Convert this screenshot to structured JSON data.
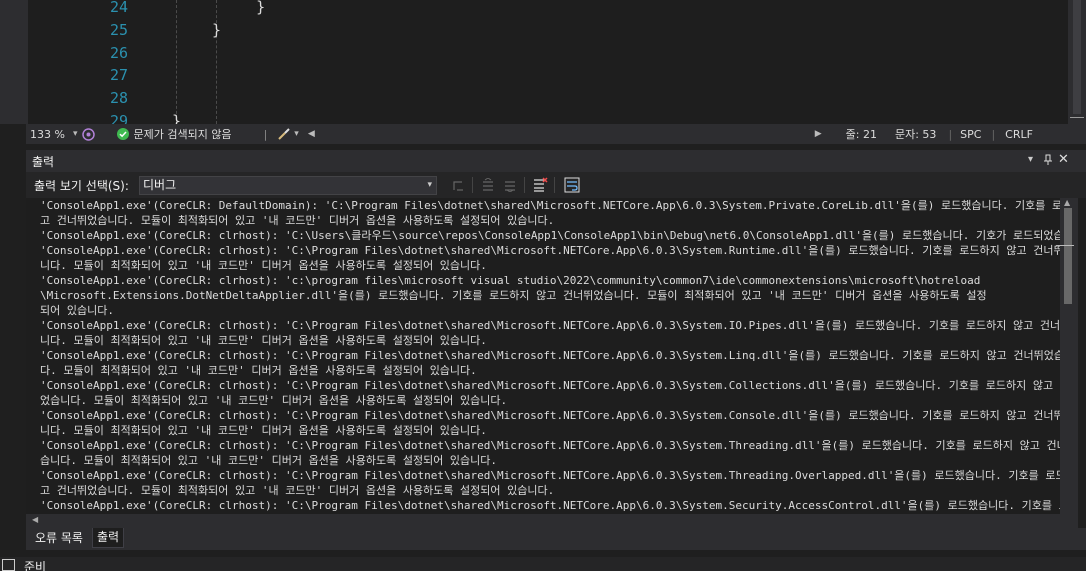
{
  "editor": {
    "lines": [
      {
        "num": "24",
        "code": "    }"
      },
      {
        "num": "25",
        "code": "}"
      },
      {
        "num": "26",
        "code": ""
      },
      {
        "num": "27",
        "code": ""
      },
      {
        "num": "28",
        "code": ""
      },
      {
        "num": "29",
        "code": "}"
      }
    ]
  },
  "editor_status": {
    "zoom": "133 %",
    "issues": "문제가 검색되지 않음",
    "line": "줄: 21",
    "char": "문자: 53",
    "whitespace": "SPC",
    "line_ending": "CRLF"
  },
  "output": {
    "title": "출력",
    "source_label": "출력 보기 선택(S):",
    "source_value": "디버그",
    "log": [
      "'ConsoleApp1.exe'(CoreCLR: DefaultDomain): 'C:\\Program Files\\dotnet\\shared\\Microsoft.NETCore.App\\6.0.3\\System.Private.CoreLib.dll'을(를) 로드했습니다. 기호를 로드하지 않",
      "   고 건너뛰었습니다. 모듈이 최적화되어 있고 '내 코드만' 디버거 옵션을 사용하도록 설정되어 있습니다.",
      "'ConsoleApp1.exe'(CoreCLR: clrhost): 'C:\\Users\\클라우드\\source\\repos\\ConsoleApp1\\ConsoleApp1\\bin\\Debug\\net6.0\\ConsoleApp1.dll'을(를) 로드했습니다. 기호가 로드되었습니다.",
      "'ConsoleApp1.exe'(CoreCLR: clrhost): 'C:\\Program Files\\dotnet\\shared\\Microsoft.NETCore.App\\6.0.3\\System.Runtime.dll'을(를) 로드했습니다. 기호를 로드하지 않고 건너뛰었습",
      "   니다. 모듈이 최적화되어 있고 '내 코드만' 디버거 옵션을 사용하도록 설정되어 있습니다.",
      "'ConsoleApp1.exe'(CoreCLR: clrhost): 'c:\\program files\\microsoft visual studio\\2022\\community\\common7\\ide\\commonextensions\\microsoft\\hotreload",
      "   \\Microsoft.Extensions.DotNetDeltaApplier.dll'을(를) 로드했습니다. 기호를 로드하지 않고 건너뛰었습니다. 모듈이 최적화되어 있고 '내 코드만' 디버거 옵션을 사용하도록 설정",
      "   되어 있습니다.",
      "'ConsoleApp1.exe'(CoreCLR: clrhost): 'C:\\Program Files\\dotnet\\shared\\Microsoft.NETCore.App\\6.0.3\\System.IO.Pipes.dll'을(를) 로드했습니다. 기호를 로드하지 않고 건너뛰었습",
      "   니다. 모듈이 최적화되어 있고 '내 코드만' 디버거 옵션을 사용하도록 설정되어 있습니다.",
      "'ConsoleApp1.exe'(CoreCLR: clrhost): 'C:\\Program Files\\dotnet\\shared\\Microsoft.NETCore.App\\6.0.3\\System.Linq.dll'을(를) 로드했습니다. 기호를 로드하지 않고 건너뛰었습니",
      "   다. 모듈이 최적화되어 있고 '내 코드만' 디버거 옵션을 사용하도록 설정되어 있습니다.",
      "'ConsoleApp1.exe'(CoreCLR: clrhost): 'C:\\Program Files\\dotnet\\shared\\Microsoft.NETCore.App\\6.0.3\\System.Collections.dll'을(를) 로드했습니다. 기호를 로드하지 않고 건너뛰",
      "   었습니다. 모듈이 최적화되어 있고 '내 코드만' 디버거 옵션을 사용하도록 설정되어 있습니다.",
      "'ConsoleApp1.exe'(CoreCLR: clrhost): 'C:\\Program Files\\dotnet\\shared\\Microsoft.NETCore.App\\6.0.3\\System.Console.dll'을(를) 로드했습니다. 기호를 로드하지 않고 건너뛰었습",
      "   니다. 모듈이 최적화되어 있고 '내 코드만' 디버거 옵션을 사용하도록 설정되어 있습니다.",
      "'ConsoleApp1.exe'(CoreCLR: clrhost): 'C:\\Program Files\\dotnet\\shared\\Microsoft.NETCore.App\\6.0.3\\System.Threading.dll'을(를) 로드했습니다. 기호를 로드하지 않고 건너뛰었",
      "   습니다. 모듈이 최적화되어 있고 '내 코드만' 디버거 옵션을 사용하도록 설정되어 있습니다.",
      "'ConsoleApp1.exe'(CoreCLR: clrhost): 'C:\\Program Files\\dotnet\\shared\\Microsoft.NETCore.App\\6.0.3\\System.Threading.Overlapped.dll'을(를) 로드했습니다. 기호를 로드하지 않",
      "   고 건너뛰었습니다. 모듈이 최적화되어 있고 '내 코드만' 디버거 옵션을 사용하도록 설정되어 있습니다.",
      "'ConsoleApp1.exe'(CoreCLR: clrhost): 'C:\\Program Files\\dotnet\\shared\\Microsoft.NETCore.App\\6.0.3\\System.Security.AccessControl.dll'을(를) 로드했습니다. 기호를 로드하지"
    ]
  },
  "tabs": [
    {
      "label": "오류 목록"
    },
    {
      "label": "출력"
    }
  ],
  "app_status": {
    "text": "준비"
  },
  "colors": {
    "line_number": "#2b91af",
    "ok_icon": "#3fb950",
    "accent": "#007acc"
  }
}
